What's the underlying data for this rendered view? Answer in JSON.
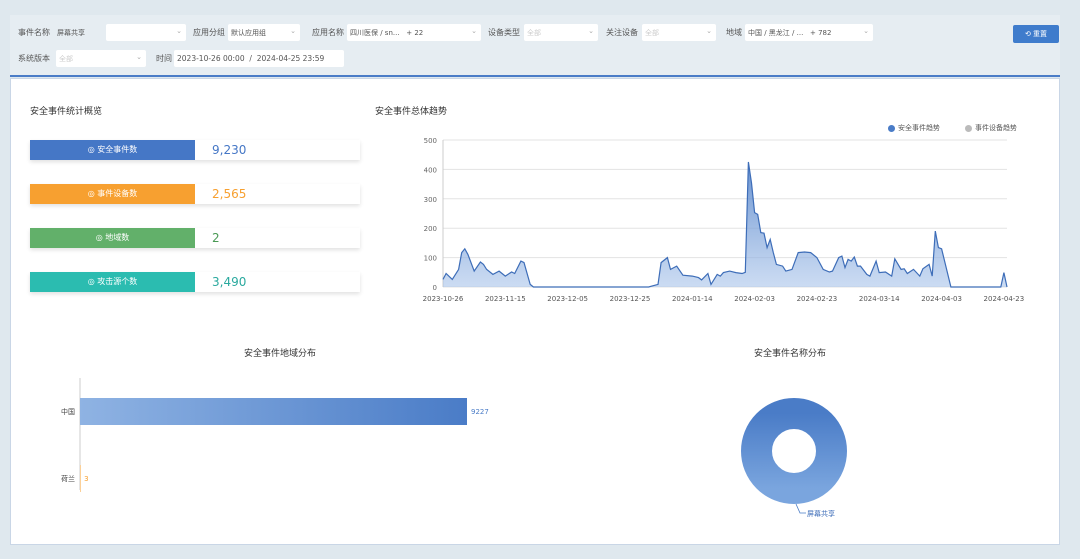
{
  "filters": {
    "event_name": {
      "label": "事件名称",
      "value": "屏幕共享"
    },
    "app_group": {
      "label": "应用分组",
      "value": "默认应用组"
    },
    "app_name": {
      "label": "应用名称",
      "value": "四川医保 / sn...",
      "extra": "+ 22"
    },
    "device_type": {
      "label": "设备类型",
      "value": "全部"
    },
    "watched_device": {
      "label": "关注设备",
      "value": "全部"
    },
    "region": {
      "label": "地域",
      "value": "中国 / 黑龙江 / ...",
      "extra": "+ 782"
    },
    "os_version": {
      "label": "系统版本",
      "value": "全部"
    },
    "time": {
      "label": "时间",
      "start": "2023-10-26 00:00",
      "sep": "/",
      "end": "2024-04-25 23:59"
    },
    "reset_label": "重置"
  },
  "overview": {
    "title": "安全事件统计概览",
    "stats": [
      {
        "label": "安全事件数",
        "value": "9,230",
        "color": "#4577c6",
        "value_color": "#4577c6",
        "icon": "search-icon"
      },
      {
        "label": "事件设备数",
        "value": "2,565",
        "color": "#f7a030",
        "value_color": "#f7a030",
        "icon": "device-icon"
      },
      {
        "label": "地域数",
        "value": "2",
        "color": "#62b06a",
        "value_color": "#4a9a55",
        "icon": "location-icon"
      },
      {
        "label": "攻击源个数",
        "value": "3,490",
        "color": "#2bbcb0",
        "value_color": "#2aa99e",
        "icon": "attack-icon"
      }
    ]
  },
  "chart_data": [
    {
      "type": "area",
      "title": "安全事件总体趋势",
      "legend": [
        {
          "name": "安全事件趋势",
          "color": "#4a7cc7"
        },
        {
          "name": "事件设备趋势",
          "color": "#bbbbbb"
        }
      ],
      "legend_position": "top-right",
      "ylim": [
        0,
        500
      ],
      "yticks": [
        0,
        100,
        200,
        300,
        400,
        500
      ],
      "xlim": [
        "2023-10-26",
        "2024-04-24"
      ],
      "xticks": [
        "2023-10-26",
        "2023-11-15",
        "2023-12-05",
        "2023-12-25",
        "2024-01-14",
        "2024-02-03",
        "2024-02-23",
        "2024-03-14",
        "2024-04-03",
        "2024-04-23"
      ],
      "grid": true,
      "series": [
        {
          "name": "安全事件趋势",
          "points": [
            [
              "2023-10-26",
              26
            ],
            [
              "2023-10-27",
              46
            ],
            [
              "2023-10-29",
              26
            ],
            [
              "2023-10-31",
              60
            ],
            [
              "2023-11-01",
              117
            ],
            [
              "2023-11-02",
              130
            ],
            [
              "2023-11-03",
              111
            ],
            [
              "2023-11-05",
              54
            ],
            [
              "2023-11-07",
              85
            ],
            [
              "2023-11-08",
              77
            ],
            [
              "2023-11-09",
              60
            ],
            [
              "2023-11-11",
              43
            ],
            [
              "2023-11-13",
              54
            ],
            [
              "2023-11-15",
              37
            ],
            [
              "2023-11-17",
              51
            ],
            [
              "2023-11-18",
              46
            ],
            [
              "2023-11-20",
              88
            ],
            [
              "2023-11-21",
              83
            ],
            [
              "2023-11-23",
              9
            ],
            [
              "2023-11-24",
              0
            ],
            [
              "2023-12-31",
              0
            ],
            [
              "2024-01-01",
              3
            ],
            [
              "2024-01-03",
              9
            ],
            [
              "2024-01-04",
              83
            ],
            [
              "2024-01-06",
              100
            ],
            [
              "2024-01-07",
              60
            ],
            [
              "2024-01-09",
              71
            ],
            [
              "2024-01-11",
              40
            ],
            [
              "2024-01-14",
              37
            ],
            [
              "2024-01-16",
              32
            ],
            [
              "2024-01-17",
              24
            ],
            [
              "2024-01-19",
              46
            ],
            [
              "2024-01-20",
              9
            ],
            [
              "2024-01-22",
              43
            ],
            [
              "2024-01-23",
              37
            ],
            [
              "2024-01-24",
              49
            ],
            [
              "2024-01-26",
              54
            ],
            [
              "2024-01-28",
              49
            ],
            [
              "2024-01-30",
              46
            ],
            [
              "2024-01-31",
              50
            ],
            [
              "2024-02-01",
              425
            ],
            [
              "2024-02-02",
              354
            ],
            [
              "2024-02-03",
              253
            ],
            [
              "2024-02-04",
              247
            ],
            [
              "2024-02-05",
              185
            ],
            [
              "2024-02-06",
              183
            ],
            [
              "2024-02-07",
              134
            ],
            [
              "2024-02-08",
              162
            ],
            [
              "2024-02-09",
              117
            ],
            [
              "2024-02-10",
              77
            ],
            [
              "2024-02-12",
              71
            ],
            [
              "2024-02-13",
              54
            ],
            [
              "2024-02-15",
              60
            ],
            [
              "2024-02-17",
              117
            ],
            [
              "2024-02-19",
              119
            ],
            [
              "2024-02-21",
              117
            ],
            [
              "2024-02-23",
              100
            ],
            [
              "2024-02-25",
              60
            ],
            [
              "2024-02-27",
              51
            ],
            [
              "2024-02-28",
              54
            ],
            [
              "2024-03-01",
              100
            ],
            [
              "2024-03-02",
              105
            ],
            [
              "2024-03-03",
              66
            ],
            [
              "2024-03-04",
              94
            ],
            [
              "2024-03-05",
              88
            ],
            [
              "2024-03-06",
              102
            ],
            [
              "2024-03-07",
              71
            ],
            [
              "2024-03-08",
              71
            ],
            [
              "2024-03-10",
              43
            ],
            [
              "2024-03-11",
              37
            ],
            [
              "2024-03-13",
              88
            ],
            [
              "2024-03-14",
              49
            ],
            [
              "2024-03-16",
              51
            ],
            [
              "2024-03-18",
              37
            ],
            [
              "2024-03-19",
              96
            ],
            [
              "2024-03-21",
              60
            ],
            [
              "2024-03-22",
              62
            ],
            [
              "2024-03-23",
              46
            ],
            [
              "2024-03-25",
              60
            ],
            [
              "2024-03-27",
              37
            ],
            [
              "2024-03-28",
              62
            ],
            [
              "2024-03-30",
              77
            ],
            [
              "2024-03-31",
              37
            ],
            [
              "2024-04-01",
              190
            ],
            [
              "2024-04-02",
              134
            ],
            [
              "2024-04-03",
              130
            ],
            [
              "2024-04-06",
              0
            ],
            [
              "2024-04-22",
              0
            ],
            [
              "2024-04-23",
              49
            ],
            [
              "2024-04-24",
              0
            ]
          ]
        }
      ]
    },
    {
      "type": "bar",
      "orientation": "horizontal",
      "title": "安全事件地域分布",
      "categories": [
        "中国",
        "荷兰"
      ],
      "values": [
        9227,
        3
      ],
      "colors": [
        "#4a7cc7",
        "#f7a030"
      ]
    },
    {
      "type": "pie",
      "subtype": "donut",
      "title": "安全事件名称分布",
      "slices": [
        {
          "label": "屏幕共享",
          "value": 9230,
          "color": "#4a7cc7"
        }
      ]
    }
  ]
}
